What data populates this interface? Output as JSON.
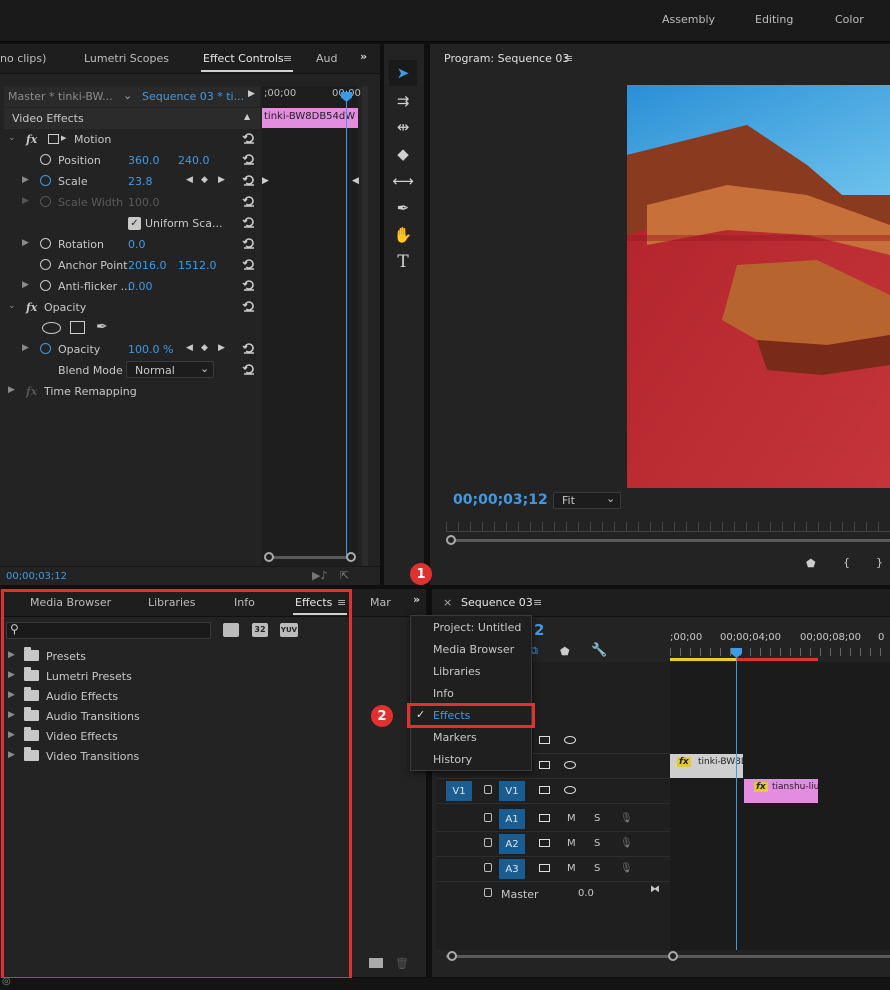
{
  "workspaces": [
    "Assembly",
    "Editing",
    "Color"
  ],
  "source_panel": {
    "tabs": [
      "no clips)",
      "Lumetri Scopes",
      "Effect Controls",
      "Aud"
    ],
    "active_tab_index": 2,
    "master_label": "Master * tinki-BW...",
    "sequence_label": "Sequence 03 * ti...",
    "timeline_start": ";00;00",
    "timeline_end": "00;00",
    "clip_name": "tinki-BW8DB54dW",
    "video_effects_header": "Video Effects",
    "rows": {
      "motion": "Motion",
      "position": "Position",
      "position_x": "360.0",
      "position_y": "240.0",
      "scale": "Scale",
      "scale_val": "23.8",
      "scale_width": "Scale Width",
      "scale_width_val": "100.0",
      "uniform_scale": "Uniform Sca...",
      "rotation": "Rotation",
      "rotation_val": "0.0",
      "anchor": "Anchor Point",
      "anchor_x": "2016.0",
      "anchor_y": "1512.0",
      "antiflicker": "Anti-flicker ...",
      "antiflicker_val": "0.00",
      "opacity_header": "Opacity",
      "opacity": "Opacity",
      "opacity_val": "100.0 %",
      "blend_mode": "Blend Mode",
      "blend_val": "Normal",
      "time_remap": "Time Remapping"
    },
    "timecode": "00;00;03;12"
  },
  "program": {
    "title": "Program: Sequence 03",
    "timecode": "00;00;03;12",
    "fit": "Fit"
  },
  "effects_panel": {
    "tabs": [
      "Media Browser",
      "Libraries",
      "Info",
      "Effects",
      "Mar"
    ],
    "active_tab_index": 3,
    "items": [
      "Presets",
      "Lumetri Presets",
      "Audio Effects",
      "Audio Transitions",
      "Video Effects",
      "Video Transitions"
    ],
    "icon_labels": [
      "32",
      "YUV"
    ]
  },
  "dropdown_menu": {
    "items": [
      "Project: Untitled",
      "Media Browser",
      "Libraries",
      "Info",
      "Effects",
      "Markers",
      "History"
    ],
    "checked": "Effects"
  },
  "annotations": [
    "1",
    "2"
  ],
  "sequence": {
    "title": "Sequence 03",
    "timecode_partial": "2",
    "ruler": [
      ";00;00",
      "00;00;04;00",
      "00;00;08;00",
      "0"
    ],
    "clips": [
      "tinki-BW8D",
      "tianshu-liu-"
    ],
    "tracks": {
      "v1_src": "V1",
      "v1": "V1",
      "a1": "A1",
      "a2": "A2",
      "a3": "A3",
      "mute": "M",
      "solo": "S",
      "master": "Master",
      "master_val": "0.0"
    }
  },
  "colors": {
    "accent": "#3f9ae5",
    "highlight": "#e03131",
    "clip_pink": "#e38ce0"
  }
}
